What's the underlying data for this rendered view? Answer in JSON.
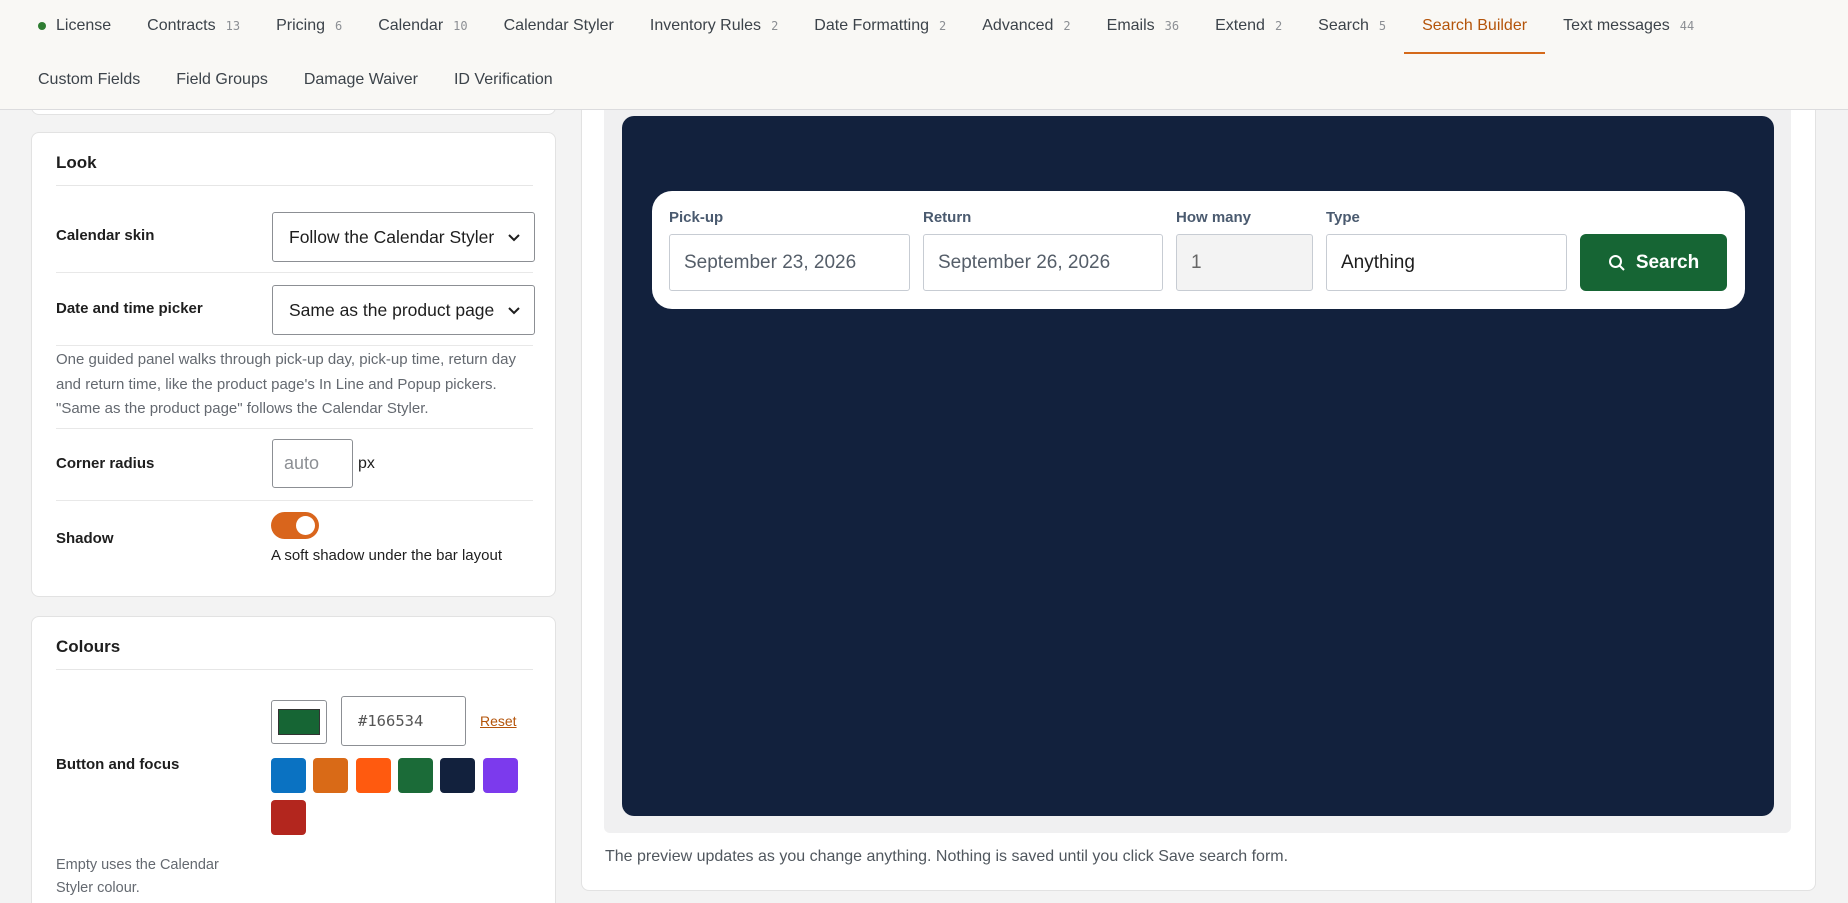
{
  "tabs_row1": [
    {
      "label": "License",
      "count": "",
      "dot": true
    },
    {
      "label": "Contracts",
      "count": "13"
    },
    {
      "label": "Pricing",
      "count": "6"
    },
    {
      "label": "Calendar",
      "count": "10"
    },
    {
      "label": "Calendar Styler",
      "count": ""
    },
    {
      "label": "Inventory Rules",
      "count": "2"
    },
    {
      "label": "Date Formatting",
      "count": "2"
    },
    {
      "label": "Advanced",
      "count": "2"
    },
    {
      "label": "Emails",
      "count": "36"
    },
    {
      "label": "Extend",
      "count": "2"
    },
    {
      "label": "Search",
      "count": "5"
    },
    {
      "label": "Search Builder",
      "count": "",
      "active": true
    },
    {
      "label": "Text messages",
      "count": "44"
    }
  ],
  "tabs_row2": [
    {
      "label": "Custom Fields"
    },
    {
      "label": "Field Groups"
    },
    {
      "label": "Damage Waiver"
    },
    {
      "label": "ID Verification"
    }
  ],
  "look": {
    "title": "Look",
    "calendar_skin_label": "Calendar skin",
    "calendar_skin_value": "Follow the Calendar Styler",
    "picker_label": "Date and time picker",
    "picker_value": "Same as the product page",
    "picker_help": "One guided panel walks through pick-up day, pick-up time, return day and return time, like the product page's In Line and Popup pickers. \"Same as the product page\" follows the Calendar Styler.",
    "corner_label": "Corner radius",
    "corner_placeholder": "auto",
    "corner_unit": "px",
    "shadow_label": "Shadow",
    "shadow_on": true,
    "shadow_desc": "A soft shadow under the bar layout"
  },
  "colours": {
    "title": "Colours",
    "button_focus_label": "Button and focus",
    "hex_value": "#166534",
    "current_color": "#166534",
    "reset_label": "Reset",
    "swatches": [
      "#0a72c2",
      "#d96a17",
      "#ff5a0f",
      "#1b6b38",
      "#12213d",
      "#7c3aed",
      "#b3261e"
    ],
    "empty_note": "Empty uses the Calendar Styler colour."
  },
  "preview": {
    "pickup_label": "Pick-up",
    "pickup_value": "September 23, 2026",
    "return_label": "Return",
    "return_value": "September 26, 2026",
    "howmany_label": "How many",
    "howmany_value": "1",
    "type_label": "Type",
    "type_value": "Anything",
    "search_label": "Search",
    "stage_color": "#12213d",
    "button_color": "#166534",
    "note": "The preview updates as you change anything. Nothing is saved until you click Save search form."
  }
}
